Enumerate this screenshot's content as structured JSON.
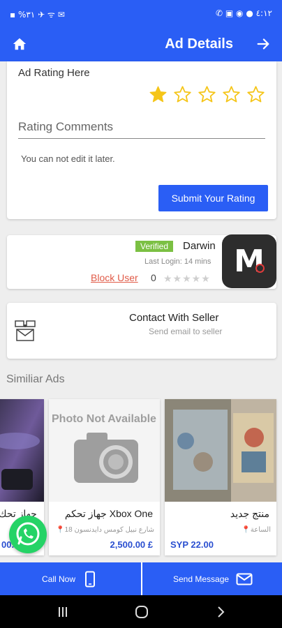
{
  "status_bar": {
    "left_text": "▪ ‎%٣١ ✈ ᯤ ✉",
    "right_text": "✆ ▣ ◉ ● ٤:١٢"
  },
  "header": {
    "title": "Ad Details"
  },
  "rating": {
    "label": "Ad Rating Here",
    "stars_filled": 1,
    "stars_total": 5,
    "comments_placeholder": "Rating Comments",
    "hint": "You can not edit it later.",
    "submit_label": "Submit Your Rating"
  },
  "seller": {
    "verified_badge": "Verified",
    "name": "Darwin",
    "last_login": "Last Login: 14 mins",
    "block_label": "Block User",
    "rating_count": "0",
    "logo_letter": "M"
  },
  "contact": {
    "title": "Contact With Seller",
    "subtitle": "Send email to seller"
  },
  "similar": {
    "title": "Similiar Ads",
    "ads": [
      {
        "name": "جهاز تحك",
        "price": "00.00"
      },
      {
        "name": "جهاز تحكم Xbox One",
        "location": "18 شارع نبيل كومس دايدنسون",
        "price": "2,500.00 £",
        "placeholder_text": "Photo Not Available"
      },
      {
        "name": "منتج جديد",
        "location": "الساعة",
        "price": "SYP 22.00"
      }
    ]
  },
  "actions": {
    "call_label": "Call Now",
    "message_label": "Send Message"
  },
  "colors": {
    "primary": "#2a5ef5",
    "star": "#f5c518",
    "verified": "#7bc043",
    "block": "#e05a47",
    "whatsapp": "#25d366"
  }
}
